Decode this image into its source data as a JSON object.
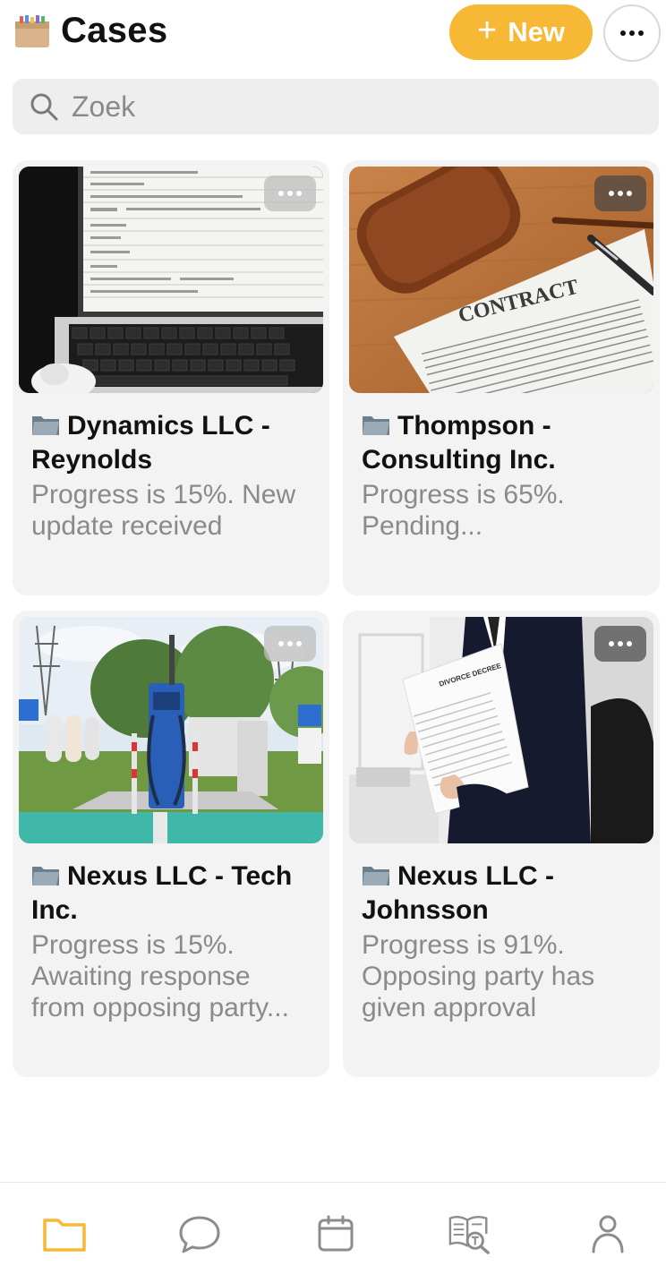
{
  "header": {
    "title": "Cases",
    "new_label": "New",
    "new_icon": "plus-icon",
    "more_icon": "more-horizontal-icon"
  },
  "search": {
    "placeholder": "Zoek",
    "icon": "search-icon"
  },
  "cases": [
    {
      "title": "Dynamics LLC - Reynolds",
      "description": "Progress is 15%. New update received",
      "progress_percent": 15,
      "image": "laptop-with-tax-form"
    },
    {
      "title": "Thompson - Consulting Inc.",
      "description": "Progress is 65%. Pending...",
      "progress_percent": 65,
      "image": "contract-document-with-pen"
    },
    {
      "title": "Nexus LLC - Tech Inc.",
      "description": "Progress is 15%. Awaiting response from opposing party...",
      "progress_percent": 15,
      "image": "ev-charging-station"
    },
    {
      "title": "Nexus LLC - Johnsson",
      "description": "Progress is 91%. Opposing party has given approval",
      "progress_percent": 91,
      "image": "person-holding-divorce-decree"
    }
  ],
  "image_text": {
    "contract": "CONTRACT",
    "divorce": "DIVORCE DECREE"
  },
  "bottom_nav": [
    {
      "icon": "folder-icon",
      "active": true
    },
    {
      "icon": "chat-bubble-icon",
      "active": false
    },
    {
      "icon": "calendar-icon",
      "active": false
    },
    {
      "icon": "document-search-icon",
      "active": false
    },
    {
      "icon": "profile-icon",
      "active": false
    }
  ],
  "colors": {
    "accent": "#f6b835",
    "card_bg": "#f3f3f3",
    "muted_text": "#8a8a8a",
    "nav_icon": "#8c8c8c"
  }
}
